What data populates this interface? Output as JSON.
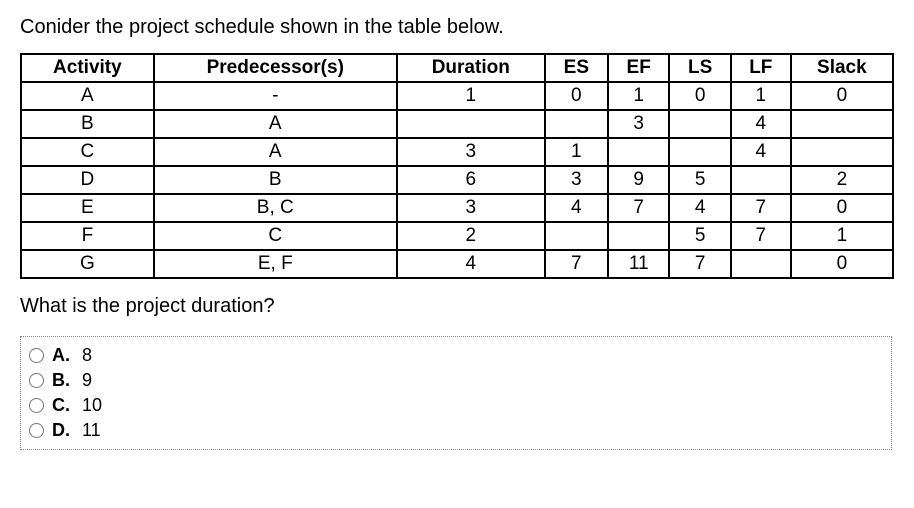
{
  "prompt": "Conider the project schedule shown in the table below.",
  "table": {
    "headers": [
      "Activity",
      "Predecessor(s)",
      "Duration",
      "ES",
      "EF",
      "LS",
      "LF",
      "Slack"
    ],
    "rows": [
      {
        "activity": "A",
        "pred": "-",
        "dur": "1",
        "es": "0",
        "ef": "1",
        "ls": "0",
        "lf": "1",
        "slack": "0"
      },
      {
        "activity": "B",
        "pred": "A",
        "dur": "",
        "es": "",
        "ef": "3",
        "ls": "",
        "lf": "4",
        "slack": ""
      },
      {
        "activity": "C",
        "pred": "A",
        "dur": "3",
        "es": "1",
        "ef": "",
        "ls": "",
        "lf": "4",
        "slack": ""
      },
      {
        "activity": "D",
        "pred": "B",
        "dur": "6",
        "es": "3",
        "ef": "9",
        "ls": "5",
        "lf": "",
        "slack": "2"
      },
      {
        "activity": "E",
        "pred": "B, C",
        "dur": "3",
        "es": "4",
        "ef": "7",
        "ls": "4",
        "lf": "7",
        "slack": "0"
      },
      {
        "activity": "F",
        "pred": "C",
        "dur": "2",
        "es": "",
        "ef": "",
        "ls": "5",
        "lf": "7",
        "slack": "1"
      },
      {
        "activity": "G",
        "pred": "E, F",
        "dur": "4",
        "es": "7",
        "ef": "11",
        "ls": "7",
        "lf": "",
        "slack": "0"
      }
    ]
  },
  "question": "What is the project duration?",
  "options": [
    {
      "letter": "A.",
      "value": "8"
    },
    {
      "letter": "B.",
      "value": "9"
    },
    {
      "letter": "C.",
      "value": "10"
    },
    {
      "letter": "D.",
      "value": "11"
    }
  ]
}
